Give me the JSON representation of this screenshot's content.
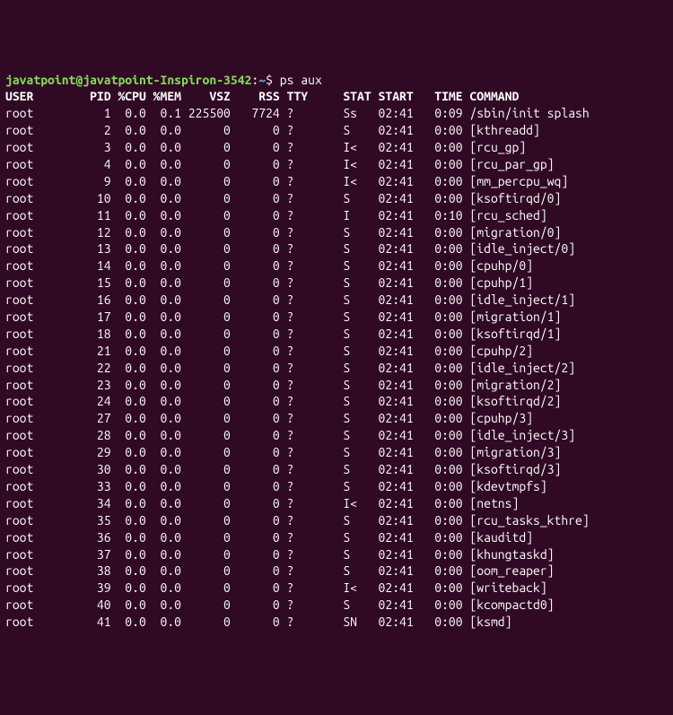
{
  "prompt": {
    "user_host": "javatpoint@javatpoint-Inspiron-3542",
    "path": "~",
    "command": "ps aux"
  },
  "headers": [
    "USER",
    "PID",
    "%CPU",
    "%MEM",
    "VSZ",
    "RSS",
    "TTY",
    "STAT",
    "START",
    "TIME",
    "COMMAND"
  ],
  "rows": [
    {
      "user": "root",
      "pid": "1",
      "cpu": "0.0",
      "mem": "0.1",
      "vsz": "225500",
      "rss": "7724",
      "tty": "?",
      "stat": "Ss",
      "start": "02:41",
      "time": "0:09",
      "cmd": "/sbin/init splash"
    },
    {
      "user": "root",
      "pid": "2",
      "cpu": "0.0",
      "mem": "0.0",
      "vsz": "0",
      "rss": "0",
      "tty": "?",
      "stat": "S",
      "start": "02:41",
      "time": "0:00",
      "cmd": "[kthreadd]"
    },
    {
      "user": "root",
      "pid": "3",
      "cpu": "0.0",
      "mem": "0.0",
      "vsz": "0",
      "rss": "0",
      "tty": "?",
      "stat": "I<",
      "start": "02:41",
      "time": "0:00",
      "cmd": "[rcu_gp]"
    },
    {
      "user": "root",
      "pid": "4",
      "cpu": "0.0",
      "mem": "0.0",
      "vsz": "0",
      "rss": "0",
      "tty": "?",
      "stat": "I<",
      "start": "02:41",
      "time": "0:00",
      "cmd": "[rcu_par_gp]"
    },
    {
      "user": "root",
      "pid": "9",
      "cpu": "0.0",
      "mem": "0.0",
      "vsz": "0",
      "rss": "0",
      "tty": "?",
      "stat": "I<",
      "start": "02:41",
      "time": "0:00",
      "cmd": "[mm_percpu_wq]"
    },
    {
      "user": "root",
      "pid": "10",
      "cpu": "0.0",
      "mem": "0.0",
      "vsz": "0",
      "rss": "0",
      "tty": "?",
      "stat": "S",
      "start": "02:41",
      "time": "0:00",
      "cmd": "[ksoftirqd/0]"
    },
    {
      "user": "root",
      "pid": "11",
      "cpu": "0.0",
      "mem": "0.0",
      "vsz": "0",
      "rss": "0",
      "tty": "?",
      "stat": "I",
      "start": "02:41",
      "time": "0:10",
      "cmd": "[rcu_sched]"
    },
    {
      "user": "root",
      "pid": "12",
      "cpu": "0.0",
      "mem": "0.0",
      "vsz": "0",
      "rss": "0",
      "tty": "?",
      "stat": "S",
      "start": "02:41",
      "time": "0:00",
      "cmd": "[migration/0]"
    },
    {
      "user": "root",
      "pid": "13",
      "cpu": "0.0",
      "mem": "0.0",
      "vsz": "0",
      "rss": "0",
      "tty": "?",
      "stat": "S",
      "start": "02:41",
      "time": "0:00",
      "cmd": "[idle_inject/0]"
    },
    {
      "user": "root",
      "pid": "14",
      "cpu": "0.0",
      "mem": "0.0",
      "vsz": "0",
      "rss": "0",
      "tty": "?",
      "stat": "S",
      "start": "02:41",
      "time": "0:00",
      "cmd": "[cpuhp/0]"
    },
    {
      "user": "root",
      "pid": "15",
      "cpu": "0.0",
      "mem": "0.0",
      "vsz": "0",
      "rss": "0",
      "tty": "?",
      "stat": "S",
      "start": "02:41",
      "time": "0:00",
      "cmd": "[cpuhp/1]"
    },
    {
      "user": "root",
      "pid": "16",
      "cpu": "0.0",
      "mem": "0.0",
      "vsz": "0",
      "rss": "0",
      "tty": "?",
      "stat": "S",
      "start": "02:41",
      "time": "0:00",
      "cmd": "[idle_inject/1]"
    },
    {
      "user": "root",
      "pid": "17",
      "cpu": "0.0",
      "mem": "0.0",
      "vsz": "0",
      "rss": "0",
      "tty": "?",
      "stat": "S",
      "start": "02:41",
      "time": "0:00",
      "cmd": "[migration/1]"
    },
    {
      "user": "root",
      "pid": "18",
      "cpu": "0.0",
      "mem": "0.0",
      "vsz": "0",
      "rss": "0",
      "tty": "?",
      "stat": "S",
      "start": "02:41",
      "time": "0:00",
      "cmd": "[ksoftirqd/1]"
    },
    {
      "user": "root",
      "pid": "21",
      "cpu": "0.0",
      "mem": "0.0",
      "vsz": "0",
      "rss": "0",
      "tty": "?",
      "stat": "S",
      "start": "02:41",
      "time": "0:00",
      "cmd": "[cpuhp/2]"
    },
    {
      "user": "root",
      "pid": "22",
      "cpu": "0.0",
      "mem": "0.0",
      "vsz": "0",
      "rss": "0",
      "tty": "?",
      "stat": "S",
      "start": "02:41",
      "time": "0:00",
      "cmd": "[idle_inject/2]"
    },
    {
      "user": "root",
      "pid": "23",
      "cpu": "0.0",
      "mem": "0.0",
      "vsz": "0",
      "rss": "0",
      "tty": "?",
      "stat": "S",
      "start": "02:41",
      "time": "0:00",
      "cmd": "[migration/2]"
    },
    {
      "user": "root",
      "pid": "24",
      "cpu": "0.0",
      "mem": "0.0",
      "vsz": "0",
      "rss": "0",
      "tty": "?",
      "stat": "S",
      "start": "02:41",
      "time": "0:00",
      "cmd": "[ksoftirqd/2]"
    },
    {
      "user": "root",
      "pid": "27",
      "cpu": "0.0",
      "mem": "0.0",
      "vsz": "0",
      "rss": "0",
      "tty": "?",
      "stat": "S",
      "start": "02:41",
      "time": "0:00",
      "cmd": "[cpuhp/3]"
    },
    {
      "user": "root",
      "pid": "28",
      "cpu": "0.0",
      "mem": "0.0",
      "vsz": "0",
      "rss": "0",
      "tty": "?",
      "stat": "S",
      "start": "02:41",
      "time": "0:00",
      "cmd": "[idle_inject/3]"
    },
    {
      "user": "root",
      "pid": "29",
      "cpu": "0.0",
      "mem": "0.0",
      "vsz": "0",
      "rss": "0",
      "tty": "?",
      "stat": "S",
      "start": "02:41",
      "time": "0:00",
      "cmd": "[migration/3]"
    },
    {
      "user": "root",
      "pid": "30",
      "cpu": "0.0",
      "mem": "0.0",
      "vsz": "0",
      "rss": "0",
      "tty": "?",
      "stat": "S",
      "start": "02:41",
      "time": "0:00",
      "cmd": "[ksoftirqd/3]"
    },
    {
      "user": "root",
      "pid": "33",
      "cpu": "0.0",
      "mem": "0.0",
      "vsz": "0",
      "rss": "0",
      "tty": "?",
      "stat": "S",
      "start": "02:41",
      "time": "0:00",
      "cmd": "[kdevtmpfs]"
    },
    {
      "user": "root",
      "pid": "34",
      "cpu": "0.0",
      "mem": "0.0",
      "vsz": "0",
      "rss": "0",
      "tty": "?",
      "stat": "I<",
      "start": "02:41",
      "time": "0:00",
      "cmd": "[netns]"
    },
    {
      "user": "root",
      "pid": "35",
      "cpu": "0.0",
      "mem": "0.0",
      "vsz": "0",
      "rss": "0",
      "tty": "?",
      "stat": "S",
      "start": "02:41",
      "time": "0:00",
      "cmd": "[rcu_tasks_kthre]"
    },
    {
      "user": "root",
      "pid": "36",
      "cpu": "0.0",
      "mem": "0.0",
      "vsz": "0",
      "rss": "0",
      "tty": "?",
      "stat": "S",
      "start": "02:41",
      "time": "0:00",
      "cmd": "[kauditd]"
    },
    {
      "user": "root",
      "pid": "37",
      "cpu": "0.0",
      "mem": "0.0",
      "vsz": "0",
      "rss": "0",
      "tty": "?",
      "stat": "S",
      "start": "02:41",
      "time": "0:00",
      "cmd": "[khungtaskd]"
    },
    {
      "user": "root",
      "pid": "38",
      "cpu": "0.0",
      "mem": "0.0",
      "vsz": "0",
      "rss": "0",
      "tty": "?",
      "stat": "S",
      "start": "02:41",
      "time": "0:00",
      "cmd": "[oom_reaper]"
    },
    {
      "user": "root",
      "pid": "39",
      "cpu": "0.0",
      "mem": "0.0",
      "vsz": "0",
      "rss": "0",
      "tty": "?",
      "stat": "I<",
      "start": "02:41",
      "time": "0:00",
      "cmd": "[writeback]"
    },
    {
      "user": "root",
      "pid": "40",
      "cpu": "0.0",
      "mem": "0.0",
      "vsz": "0",
      "rss": "0",
      "tty": "?",
      "stat": "S",
      "start": "02:41",
      "time": "0:00",
      "cmd": "[kcompactd0]"
    },
    {
      "user": "root",
      "pid": "41",
      "cpu": "0.0",
      "mem": "0.0",
      "vsz": "0",
      "rss": "0",
      "tty": "?",
      "stat": "SN",
      "start": "02:41",
      "time": "0:00",
      "cmd": "[ksmd]"
    }
  ]
}
